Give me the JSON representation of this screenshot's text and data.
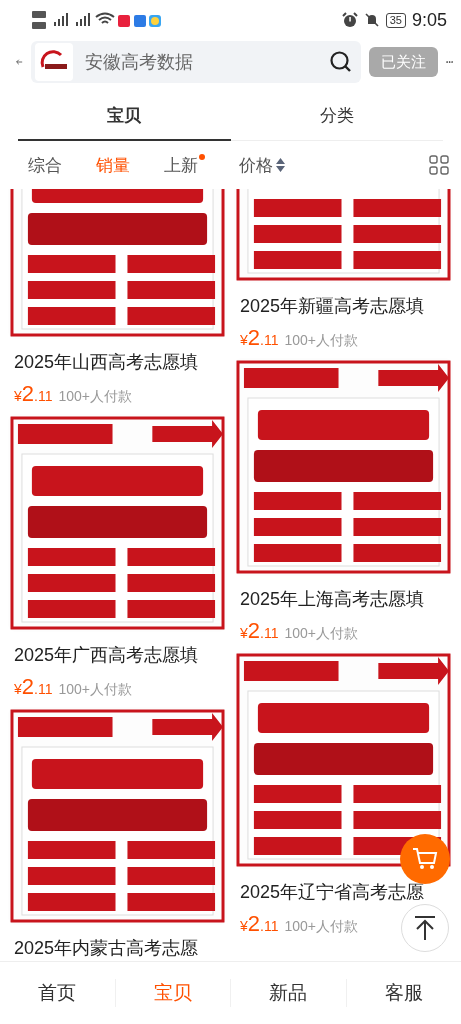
{
  "status_bar": {
    "battery": "35",
    "time": "9:05"
  },
  "header": {
    "search": {
      "placeholder": "安徽高考数据"
    },
    "follow_button": {
      "label": "已关注",
      "followed": true
    }
  },
  "tabs": [
    {
      "label": "宝贝",
      "selected": true
    },
    {
      "label": "分类",
      "selected": false
    }
  ],
  "filters": [
    {
      "label": "综合",
      "selected": false,
      "kind": "plain",
      "new_dot": false
    },
    {
      "label": "销量",
      "selected": true,
      "kind": "plain",
      "new_dot": false
    },
    {
      "label": "上新",
      "selected": false,
      "kind": "plain",
      "new_dot": true
    },
    {
      "label": "价格",
      "selected": false,
      "kind": "sort",
      "new_dot": false
    }
  ],
  "columns": [
    [
      {
        "kind": "picture",
        "title": "2025年山西高考志愿填",
        "price": "¥2.11",
        "sales": "100+人付款"
      },
      {
        "kind": "picture",
        "title": "2025年广西高考志愿填",
        "price": "¥2.11",
        "sales": "100+人付款"
      },
      {
        "kind": "picture",
        "title": "2025年内蒙古高考志愿"
      }
    ],
    [
      {
        "kind": "picture",
        "title": "2025年新疆高考志愿填",
        "price": "¥2.11",
        "sales": "100+人付款"
      },
      {
        "kind": "picture",
        "title": "2025年上海高考志愿填",
        "price": "¥2.11",
        "sales": "100+人付款"
      },
      {
        "kind": "picture",
        "title": "2025年辽宁省高考志愿",
        "price": "¥2.11",
        "sales": "100+人付款"
      }
    ]
  ],
  "bottom_nav": [
    {
      "label": "首页",
      "selected": false
    },
    {
      "label": "宝贝",
      "selected": true
    },
    {
      "label": "新品",
      "selected": false
    },
    {
      "label": "客服",
      "selected": false
    }
  ]
}
